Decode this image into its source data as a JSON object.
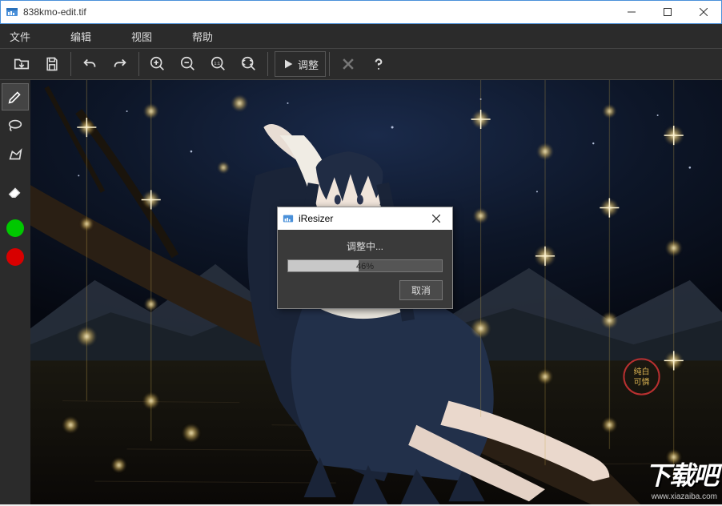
{
  "window": {
    "title": "838kmo-edit.tif"
  },
  "menu": {
    "file": "文件",
    "edit": "编辑",
    "view": "视图",
    "help": "帮助"
  },
  "toolbar": {
    "adjust_label": "调整"
  },
  "dialog": {
    "title": "iResizer",
    "status": "调整中...",
    "progress_percent": 46,
    "progress_text": "46%",
    "cancel": "取消"
  },
  "watermark": {
    "text": "下载吧",
    "url": "www.xiazaiba.com"
  },
  "artwork_stamp": {
    "line1": "纯白",
    "line2": "可憐"
  }
}
